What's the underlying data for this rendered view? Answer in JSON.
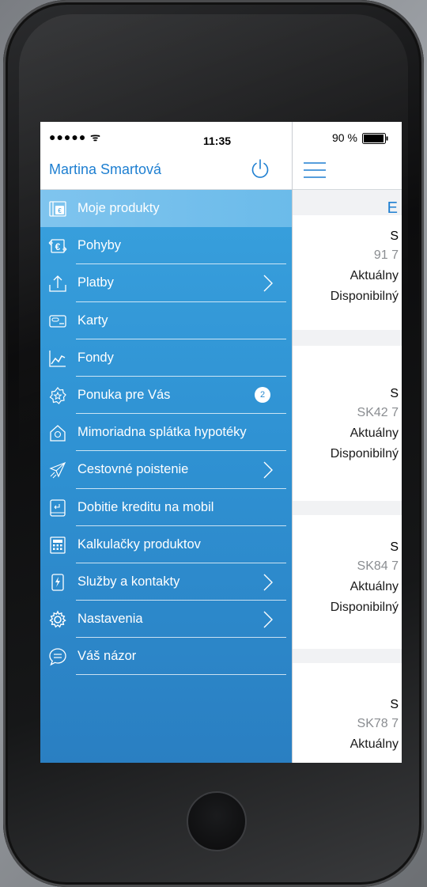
{
  "status_bar": {
    "signal": "●●●●● ᯤ",
    "time": "11:35",
    "battery": "90 %"
  },
  "menu": {
    "user_name": "Martina Smartová",
    "items": [
      {
        "label": "Moje produkty",
        "icon": "wallet-icon",
        "active": true,
        "chevron": false
      },
      {
        "label": "Pohyby",
        "icon": "euro-transfer-icon",
        "active": false,
        "chevron": false
      },
      {
        "label": "Platby",
        "icon": "upload-tray-icon",
        "active": false,
        "chevron": true
      },
      {
        "label": "Karty",
        "icon": "card-icon",
        "active": false,
        "chevron": false
      },
      {
        "label": "Fondy",
        "icon": "chart-line-icon",
        "active": false,
        "chevron": false
      },
      {
        "label": "Ponuka pre Vás",
        "icon": "badge-star-icon",
        "active": false,
        "chevron": false,
        "badge": "2"
      },
      {
        "label": "Mimoriadna splátka hypotéky",
        "icon": "house-icon",
        "active": false,
        "chevron": false
      },
      {
        "label": "Cestovné poistenie",
        "icon": "airplane-icon",
        "active": false,
        "chevron": true
      },
      {
        "label": "Dobitie kreditu na mobil",
        "icon": "mobile-topup-icon",
        "active": false,
        "chevron": false
      },
      {
        "label": "Kalkulačky produktov",
        "icon": "calculator-icon",
        "active": false,
        "chevron": false
      },
      {
        "label": "Služby a kontakty",
        "icon": "phone-lightning-icon",
        "active": false,
        "chevron": true
      },
      {
        "label": "Nastavenia",
        "icon": "gear-icon",
        "active": false,
        "chevron": true
      },
      {
        "label": "Váš názor",
        "icon": "speech-bubble-icon",
        "active": false,
        "chevron": false
      }
    ]
  },
  "content": {
    "section_letter": "E",
    "cards": [
      {
        "title": "S",
        "number": "91 7",
        "line1": "Aktuálny",
        "line2": "Disponibilný"
      },
      {
        "title": "S",
        "number": "SK42 7",
        "line1": "Aktuálny",
        "line2": "Disponibilný"
      },
      {
        "title": "S",
        "number": "SK84 7",
        "line1": "Aktuálny",
        "line2": "Disponibilný"
      },
      {
        "title": "S",
        "number": "SK78 7",
        "line1": "Aktuálny",
        "line2": ""
      }
    ]
  },
  "colors": {
    "accent": "#1e7fd1",
    "menu_bg": "#2f92d3",
    "menu_active": "#7fc4ee"
  }
}
